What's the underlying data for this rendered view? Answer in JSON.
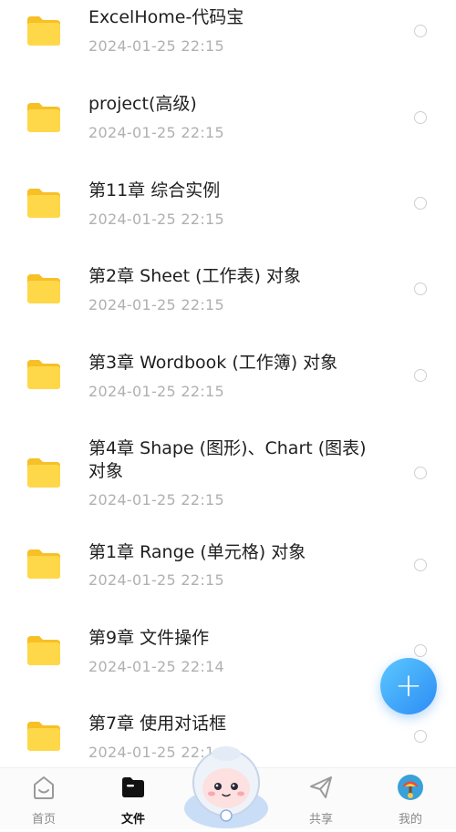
{
  "files": [
    {
      "name": "ExcelHome-代码宝",
      "date": "2024-01-25  22:15"
    },
    {
      "name": "project(高级)",
      "date": "2024-01-25  22:15"
    },
    {
      "name": "第11章 综合实例",
      "date": "2024-01-25  22:15"
    },
    {
      "name": "第2章 Sheet (工作表) 对象",
      "date": "2024-01-25  22:15"
    },
    {
      "name": "第3章 Wordbook (工作簿) 对象",
      "date": "2024-01-25  22:15"
    },
    {
      "name": "第4章 Shape (图形)、Chart (图表) 对象",
      "date": "2024-01-25  22:15"
    },
    {
      "name": "第1章 Range (单元格) 对象",
      "date": "2024-01-25  22:15"
    },
    {
      "name": "第9章 文件操作",
      "date": "2024-01-25  22:14"
    },
    {
      "name": "第7章 使用对话框",
      "date": "2024-01-25  22:1"
    }
  ],
  "fab": {
    "label": "+"
  },
  "tabs": {
    "home": "首页",
    "files": "文件",
    "share": "共享",
    "mine": "我的"
  },
  "colors": {
    "folder": "#ffd23f",
    "accent": "#2c8cf4",
    "date_text": "#b0b0b0"
  },
  "icons": {
    "folder": "folder-icon",
    "home": "smile-home-icon",
    "files": "file-folder-icon",
    "share": "paper-plane-icon",
    "mine": "avatar-icon",
    "fab": "plus-icon"
  }
}
